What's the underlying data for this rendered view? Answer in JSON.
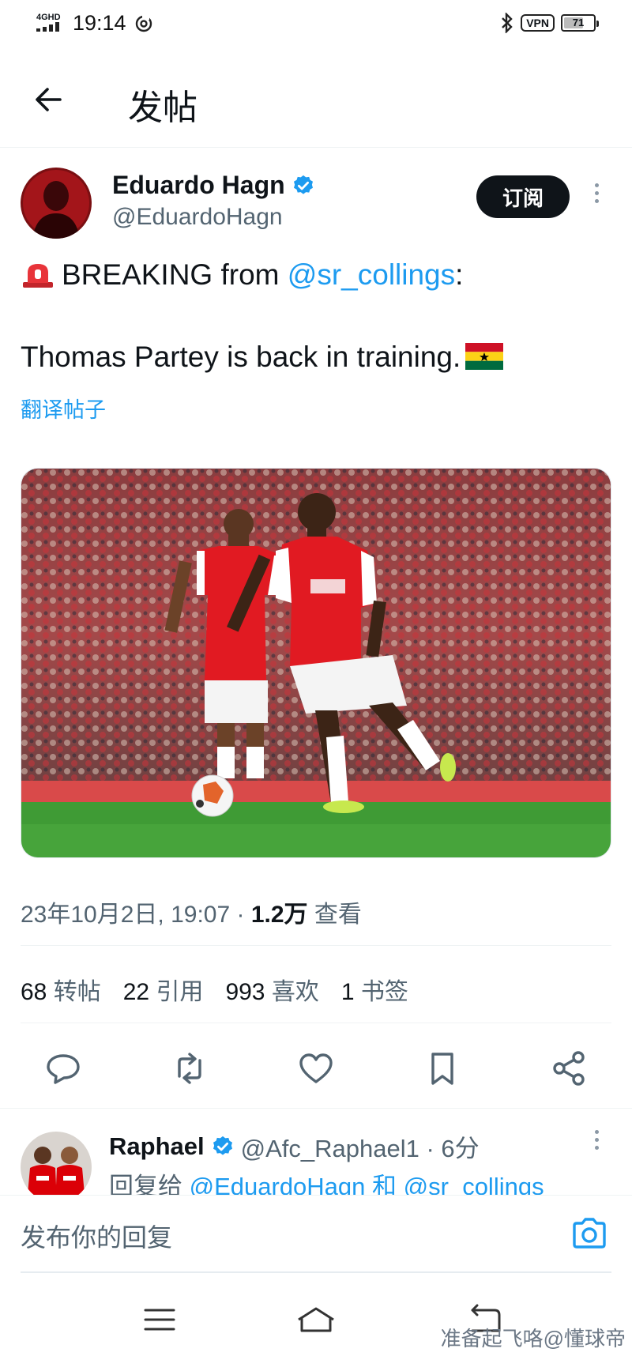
{
  "status_bar": {
    "network": "4GHD",
    "time": "19:14",
    "vpn": "VPN",
    "battery": "71",
    "battery_level": 0.71
  },
  "header": {
    "back_icon": "arrow-left-icon",
    "title": "发帖"
  },
  "tweet": {
    "author_name": "Eduardo Hagn",
    "author_handle": "@EduardoHagn",
    "subscribe_label": "订阅",
    "line1_prefix": "BREAKING from ",
    "line1_mention": "@sr_collings",
    "line1_suffix": ":",
    "line2": "Thomas Partey is back in training.",
    "translate": "翻译帖子",
    "timestamp": "23年10月2日, 19:07 · ",
    "views_count": "1.2万",
    "views_label": " 查看"
  },
  "stats": [
    {
      "num": "68",
      "label": "转帖"
    },
    {
      "num": "22",
      "label": "引用"
    },
    {
      "num": "993",
      "label": "喜欢"
    },
    {
      "num": "1",
      "label": "书签"
    }
  ],
  "actions": [
    "reply-icon",
    "retweet-icon",
    "like-icon",
    "bookmark-icon",
    "share-icon"
  ],
  "reply": {
    "name": "Raphael",
    "handle": "@Afc_Raphael1",
    "time": " · 6分",
    "reply_to_prefix": "回复给 ",
    "reply_to_1": "@EduardoHagn",
    "reply_to_joiner": " 和 ",
    "reply_to_2": "@sr_collings"
  },
  "composer": {
    "placeholder": "发布你的回复"
  },
  "watermark": "准备起飞咯@懂球帝",
  "colors": {
    "link": "#1d9bf0",
    "text": "#0f1419",
    "muted": "#536471",
    "arsenal_red": "#db0007",
    "pitch_green": "#3f9b35"
  }
}
